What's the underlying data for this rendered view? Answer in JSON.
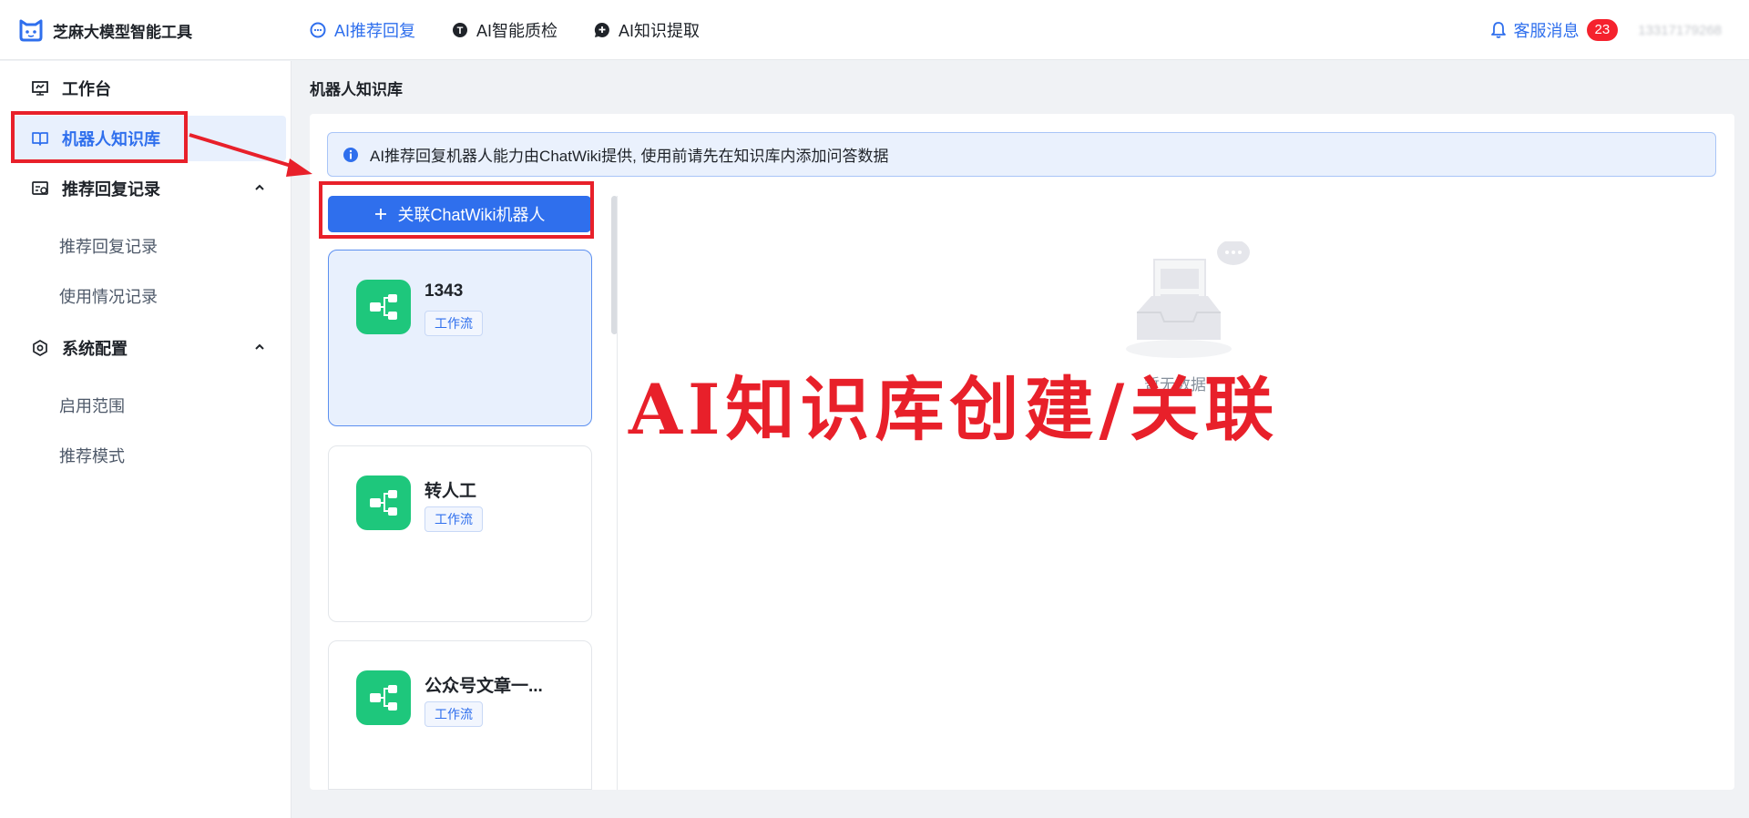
{
  "header": {
    "brand": "芝麻大模型智能工具",
    "nav": [
      {
        "label": "AI推荐回复",
        "active": true,
        "icon": "chat-bubble-icon"
      },
      {
        "label": "AI智能质检",
        "active": false,
        "icon": "quality-check-icon"
      },
      {
        "label": "AI知识提取",
        "active": false,
        "icon": "knowledge-extract-icon"
      }
    ],
    "service_msg": "客服消息",
    "badge_count": "23",
    "phone": "13317179268"
  },
  "sidebar": {
    "items": [
      {
        "label": "工作台",
        "icon": "monitor-icon"
      },
      {
        "label": "机器人知识库",
        "icon": "book-icon",
        "active": true
      },
      {
        "label": "推荐回复记录",
        "icon": "record-icon",
        "expanded": true
      },
      {
        "label": "系统配置",
        "icon": "settings-icon",
        "expanded": true
      }
    ],
    "sub_reply": [
      "推荐回复记录",
      "使用情况记录"
    ],
    "sub_config": [
      "启用范围",
      "推荐模式"
    ]
  },
  "main": {
    "page_title": "机器人知识库",
    "notice": "AI推荐回复机器人能力由ChatWiki提供, 使用前请先在知识库内添加问答数据",
    "add_button": "关联ChatWiki机器人",
    "cards": [
      {
        "name": "1343",
        "tag": "工作流",
        "selected": true
      },
      {
        "name": "转人工",
        "tag": "工作流",
        "selected": false
      },
      {
        "name": "公众号文章一...",
        "tag": "工作流",
        "selected": false
      }
    ],
    "empty_text": "暂无数据"
  },
  "annotation": {
    "text": "AI知识库创建/关联"
  },
  "colors": {
    "primary": "#2f6fed",
    "card_icon": "#1ec77c",
    "annotation": "#e8202a",
    "badge": "#f5222d"
  }
}
